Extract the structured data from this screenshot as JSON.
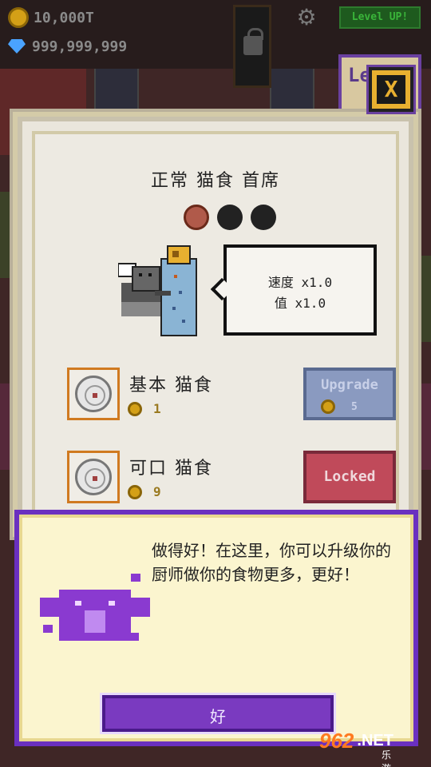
{
  "hud": {
    "coins": "10,000T",
    "gems": "999,999,999",
    "level_up_label": "Level UP!",
    "background_level_text": "Lev"
  },
  "panel": {
    "title": "正常 猫食 首席",
    "stats": {
      "speed": "速度 x1.0",
      "value": "值 x1.0"
    },
    "foods": [
      {
        "name": "基本 猫食",
        "cost": "1",
        "button_label": "Upgrade",
        "button_cost": "5",
        "state": "upgrade"
      },
      {
        "name": "可口 猫食",
        "cost": "9",
        "button_label": "Locked",
        "state": "locked"
      }
    ],
    "close_label": "X"
  },
  "dialog": {
    "message": "做得好！在这里，你可以升级你的厨师做你的食物更多，更好！",
    "ok_label": "好"
  },
  "watermark": {
    "brand": "962",
    "suffix": ".NET",
    "subtitle": "乐游网"
  },
  "colors": {
    "accent_purple": "#6a30c0",
    "upgrade_blue": "#8a9ac0",
    "locked_red": "#c04a5a",
    "coin_gold": "#d4a017"
  }
}
